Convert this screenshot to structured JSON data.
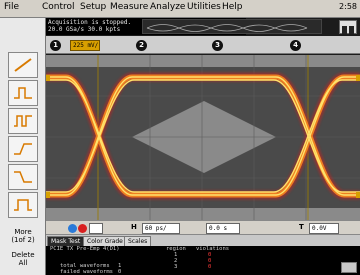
{
  "menu": {
    "items": [
      "File",
      "Control",
      "Setup",
      "Measure",
      "Analyze",
      "Utilities",
      "Help"
    ],
    "time": "2:58"
  },
  "status": {
    "line1": "Acquisition is stopped.",
    "line2": "20.0 GSa/s  30.0 kpts"
  },
  "channels": {
    "ch1_scale": "225 mV/",
    "labels": [
      "1",
      "2",
      "3",
      "4"
    ]
  },
  "toolbar_left": {
    "more_label": "More",
    "more_sub": "(1of 2)",
    "delete_label": "Delete",
    "delete_sub": "All"
  },
  "controls": {
    "h_label": "H",
    "timebase": "60 ps/",
    "delay": "0.0 s",
    "trigger_label": "T",
    "trigger_level": "0.0V"
  },
  "tabs": [
    "Mask Test",
    "Color Grade",
    "Scales"
  ],
  "results": {
    "test_name": "PCIE TX Pre-Emp 4(D1)",
    "region_header": "region",
    "violations_header": "violations",
    "regions": [
      "1",
      "2",
      "3"
    ],
    "violations": [
      "0",
      "0",
      "0"
    ],
    "total_waveforms_label": "total waveforms",
    "total_waveforms_value": "1",
    "failed_label": "failed waveforms",
    "failed_value": "0"
  },
  "colors": {
    "eye_core": "#ffe26a",
    "eye_mid": "#ff8a1e",
    "eye_edge": "#c8201e",
    "mask_fill": "#8a8a8a",
    "plot_bg": "#4a4a4a",
    "channel1": "#d8a000"
  }
}
